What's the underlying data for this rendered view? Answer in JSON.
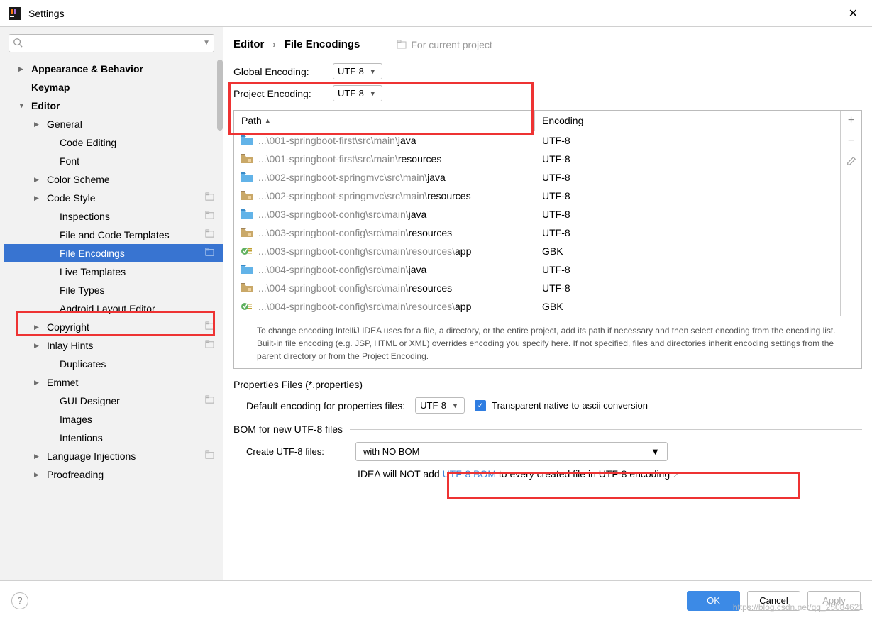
{
  "window": {
    "title": "Settings"
  },
  "breadcrumb": {
    "a": "Editor",
    "b": "File Encodings",
    "hint": "For current project"
  },
  "search": {
    "placeholder": ""
  },
  "sidebar": {
    "items": [
      {
        "label": "Appearance & Behavior",
        "depth": 1,
        "arrow": "right",
        "bold": true
      },
      {
        "label": "Keymap",
        "depth": 1,
        "arrow": "",
        "bold": true
      },
      {
        "label": "Editor",
        "depth": 1,
        "arrow": "down",
        "bold": true
      },
      {
        "label": "General",
        "depth": 2,
        "arrow": "right"
      },
      {
        "label": "Code Editing",
        "depth": 3,
        "arrow": ""
      },
      {
        "label": "Font",
        "depth": 3,
        "arrow": ""
      },
      {
        "label": "Color Scheme",
        "depth": 2,
        "arrow": "right"
      },
      {
        "label": "Code Style",
        "depth": 2,
        "arrow": "right",
        "badge": true
      },
      {
        "label": "Inspections",
        "depth": 3,
        "arrow": "",
        "badge": true
      },
      {
        "label": "File and Code Templates",
        "depth": 3,
        "arrow": "",
        "badge": true
      },
      {
        "label": "File Encodings",
        "depth": 3,
        "arrow": "",
        "badge": true,
        "selected": true
      },
      {
        "label": "Live Templates",
        "depth": 3,
        "arrow": ""
      },
      {
        "label": "File Types",
        "depth": 3,
        "arrow": ""
      },
      {
        "label": "Android Layout Editor",
        "depth": 3,
        "arrow": ""
      },
      {
        "label": "Copyright",
        "depth": 2,
        "arrow": "right",
        "badge": true
      },
      {
        "label": "Inlay Hints",
        "depth": 2,
        "arrow": "right",
        "badge": true
      },
      {
        "label": "Duplicates",
        "depth": 3,
        "arrow": ""
      },
      {
        "label": "Emmet",
        "depth": 2,
        "arrow": "right"
      },
      {
        "label": "GUI Designer",
        "depth": 3,
        "arrow": "",
        "badge": true
      },
      {
        "label": "Images",
        "depth": 3,
        "arrow": ""
      },
      {
        "label": "Intentions",
        "depth": 3,
        "arrow": ""
      },
      {
        "label": "Language Injections",
        "depth": 2,
        "arrow": "right",
        "badge": true
      },
      {
        "label": "Proofreading",
        "depth": 2,
        "arrow": "right"
      }
    ]
  },
  "encoding": {
    "global_label": "Global Encoding:",
    "global_value": "UTF-8",
    "project_label": "Project Encoding:",
    "project_value": "UTF-8"
  },
  "table": {
    "col_path": "Path",
    "col_enc": "Encoding",
    "rows": [
      {
        "icon": "folder-blue",
        "prefix": "...\\001-springboot-first\\src\\main\\",
        "strong": "java",
        "enc": "UTF-8"
      },
      {
        "icon": "folder-tan",
        "prefix": "...\\001-springboot-first\\src\\main\\",
        "strong": "resources",
        "enc": "UTF-8"
      },
      {
        "icon": "folder-blue",
        "prefix": "...\\002-springboot-springmvc\\src\\main\\",
        "strong": "java",
        "enc": "UTF-8"
      },
      {
        "icon": "folder-tan",
        "prefix": "...\\002-springboot-springmvc\\src\\main\\",
        "strong": "resources",
        "enc": "UTF-8"
      },
      {
        "icon": "folder-blue",
        "prefix": "...\\003-springboot-config\\src\\main\\",
        "strong": "java",
        "enc": "UTF-8"
      },
      {
        "icon": "folder-tan",
        "prefix": "...\\003-springboot-config\\src\\main\\",
        "strong": "resources",
        "enc": "UTF-8"
      },
      {
        "icon": "props",
        "prefix": "...\\003-springboot-config\\src\\main\\resources\\",
        "strong": "app",
        "enc": "GBK"
      },
      {
        "icon": "folder-blue",
        "prefix": "...\\004-springboot-config\\src\\main\\",
        "strong": "java",
        "enc": "UTF-8"
      },
      {
        "icon": "folder-tan",
        "prefix": "...\\004-springboot-config\\src\\main\\",
        "strong": "resources",
        "enc": "UTF-8"
      },
      {
        "icon": "props",
        "prefix": "...\\004-springboot-config\\src\\main\\resources\\",
        "strong": "app",
        "enc": "GBK"
      }
    ]
  },
  "help_text": "To change encoding IntelliJ IDEA uses for a file, a directory, or the entire project, add its path if necessary and then select encoding from the encoding list. Built-in file encoding (e.g. JSP, HTML or XML) overrides encoding you specify here. If not specified, files and directories inherit encoding settings from the parent directory or from the Project Encoding.",
  "properties": {
    "section": "Properties Files (*.properties)",
    "label": "Default encoding for properties files:",
    "value": "UTF-8",
    "checkbox": "Transparent native-to-ascii conversion"
  },
  "bom": {
    "section": "BOM for new UTF-8 files",
    "label": "Create UTF-8 files:",
    "value": "with NO BOM",
    "note_pre": "IDEA will NOT add ",
    "note_link": "UTF-8 BOM",
    "note_post": " to every created file in UTF-8 encoding"
  },
  "footer": {
    "ok": "OK",
    "cancel": "Cancel",
    "apply": "Apply"
  },
  "watermark": "https://blog.csdn.net/qq_25084621"
}
